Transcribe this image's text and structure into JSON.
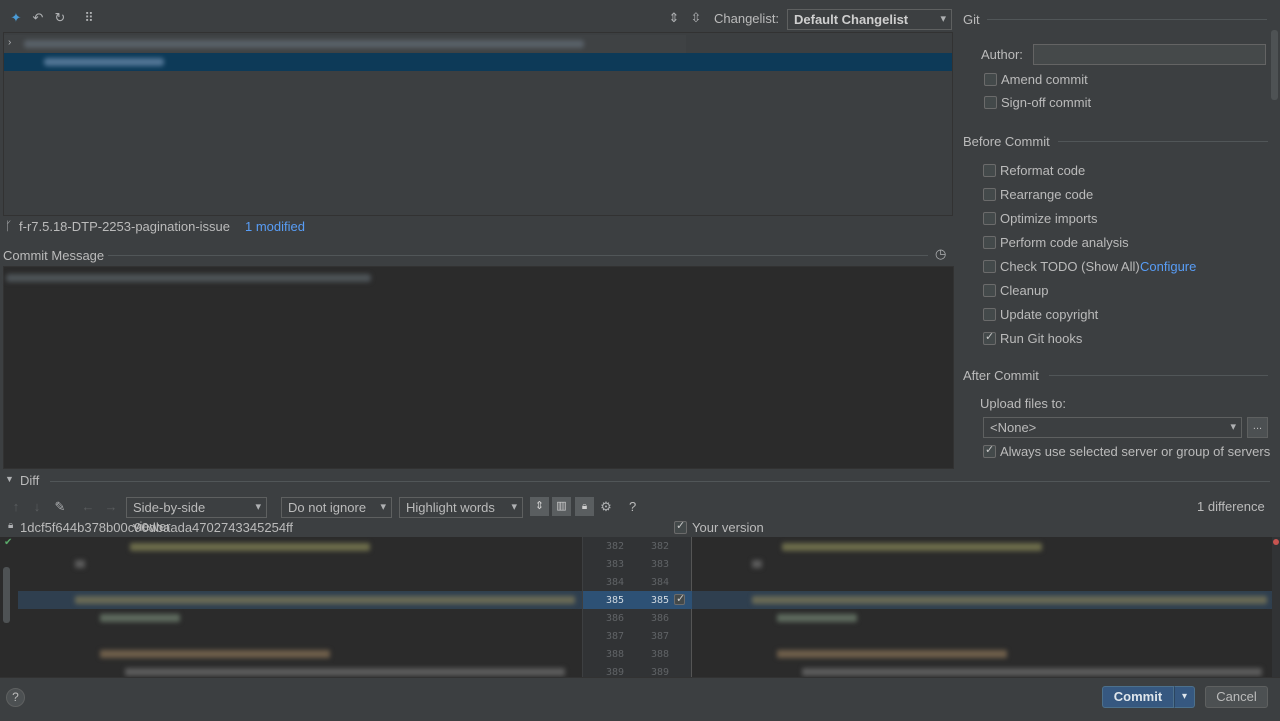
{
  "changelist": {
    "label": "Changelist:",
    "value": "Default Changelist"
  },
  "branch": {
    "name": "f-r7.5.18-DTP-2253-pagination-issue",
    "modified": "1 modified"
  },
  "commit_message": {
    "title": "Commit Message"
  },
  "git": {
    "title": "Git",
    "author_label": "Author:",
    "author_value": "",
    "amend": "Amend commit",
    "signoff": "Sign-off commit"
  },
  "before_commit": {
    "title": "Before Commit",
    "items": [
      {
        "label": "Reformat code",
        "checked": false
      },
      {
        "label": "Rearrange code",
        "checked": false
      },
      {
        "label": "Optimize imports",
        "checked": false
      },
      {
        "label": "Perform code analysis",
        "checked": false
      },
      {
        "label": "Check TODO (Show All)",
        "checked": false,
        "link": "Configure"
      },
      {
        "label": "Cleanup",
        "checked": false
      },
      {
        "label": "Update copyright",
        "checked": false
      },
      {
        "label": "Run Git hooks",
        "checked": true
      }
    ]
  },
  "after_commit": {
    "title": "After Commit",
    "upload_label": "Upload files to:",
    "upload_value": "<None>",
    "upload_more": "...",
    "always_use": "Always use selected server or group of servers"
  },
  "diff": {
    "title": "Diff",
    "viewer": "Side-by-side viewer",
    "ignore": "Do not ignore",
    "highlight": "Highlight words",
    "help": "?",
    "differences": "1 difference",
    "left_hash": "1dcf5f644b378b00c90dbaada4702743345254ff",
    "right_label": "Your version",
    "left_lines": [
      "382",
      "383",
      "384",
      "385",
      "386",
      "387",
      "388",
      "389"
    ],
    "right_lines": [
      "382",
      "383",
      "384",
      "385",
      "386",
      "387",
      "388",
      "389"
    ]
  },
  "footer": {
    "help": "?",
    "commit": "Commit",
    "cancel": "Cancel"
  }
}
